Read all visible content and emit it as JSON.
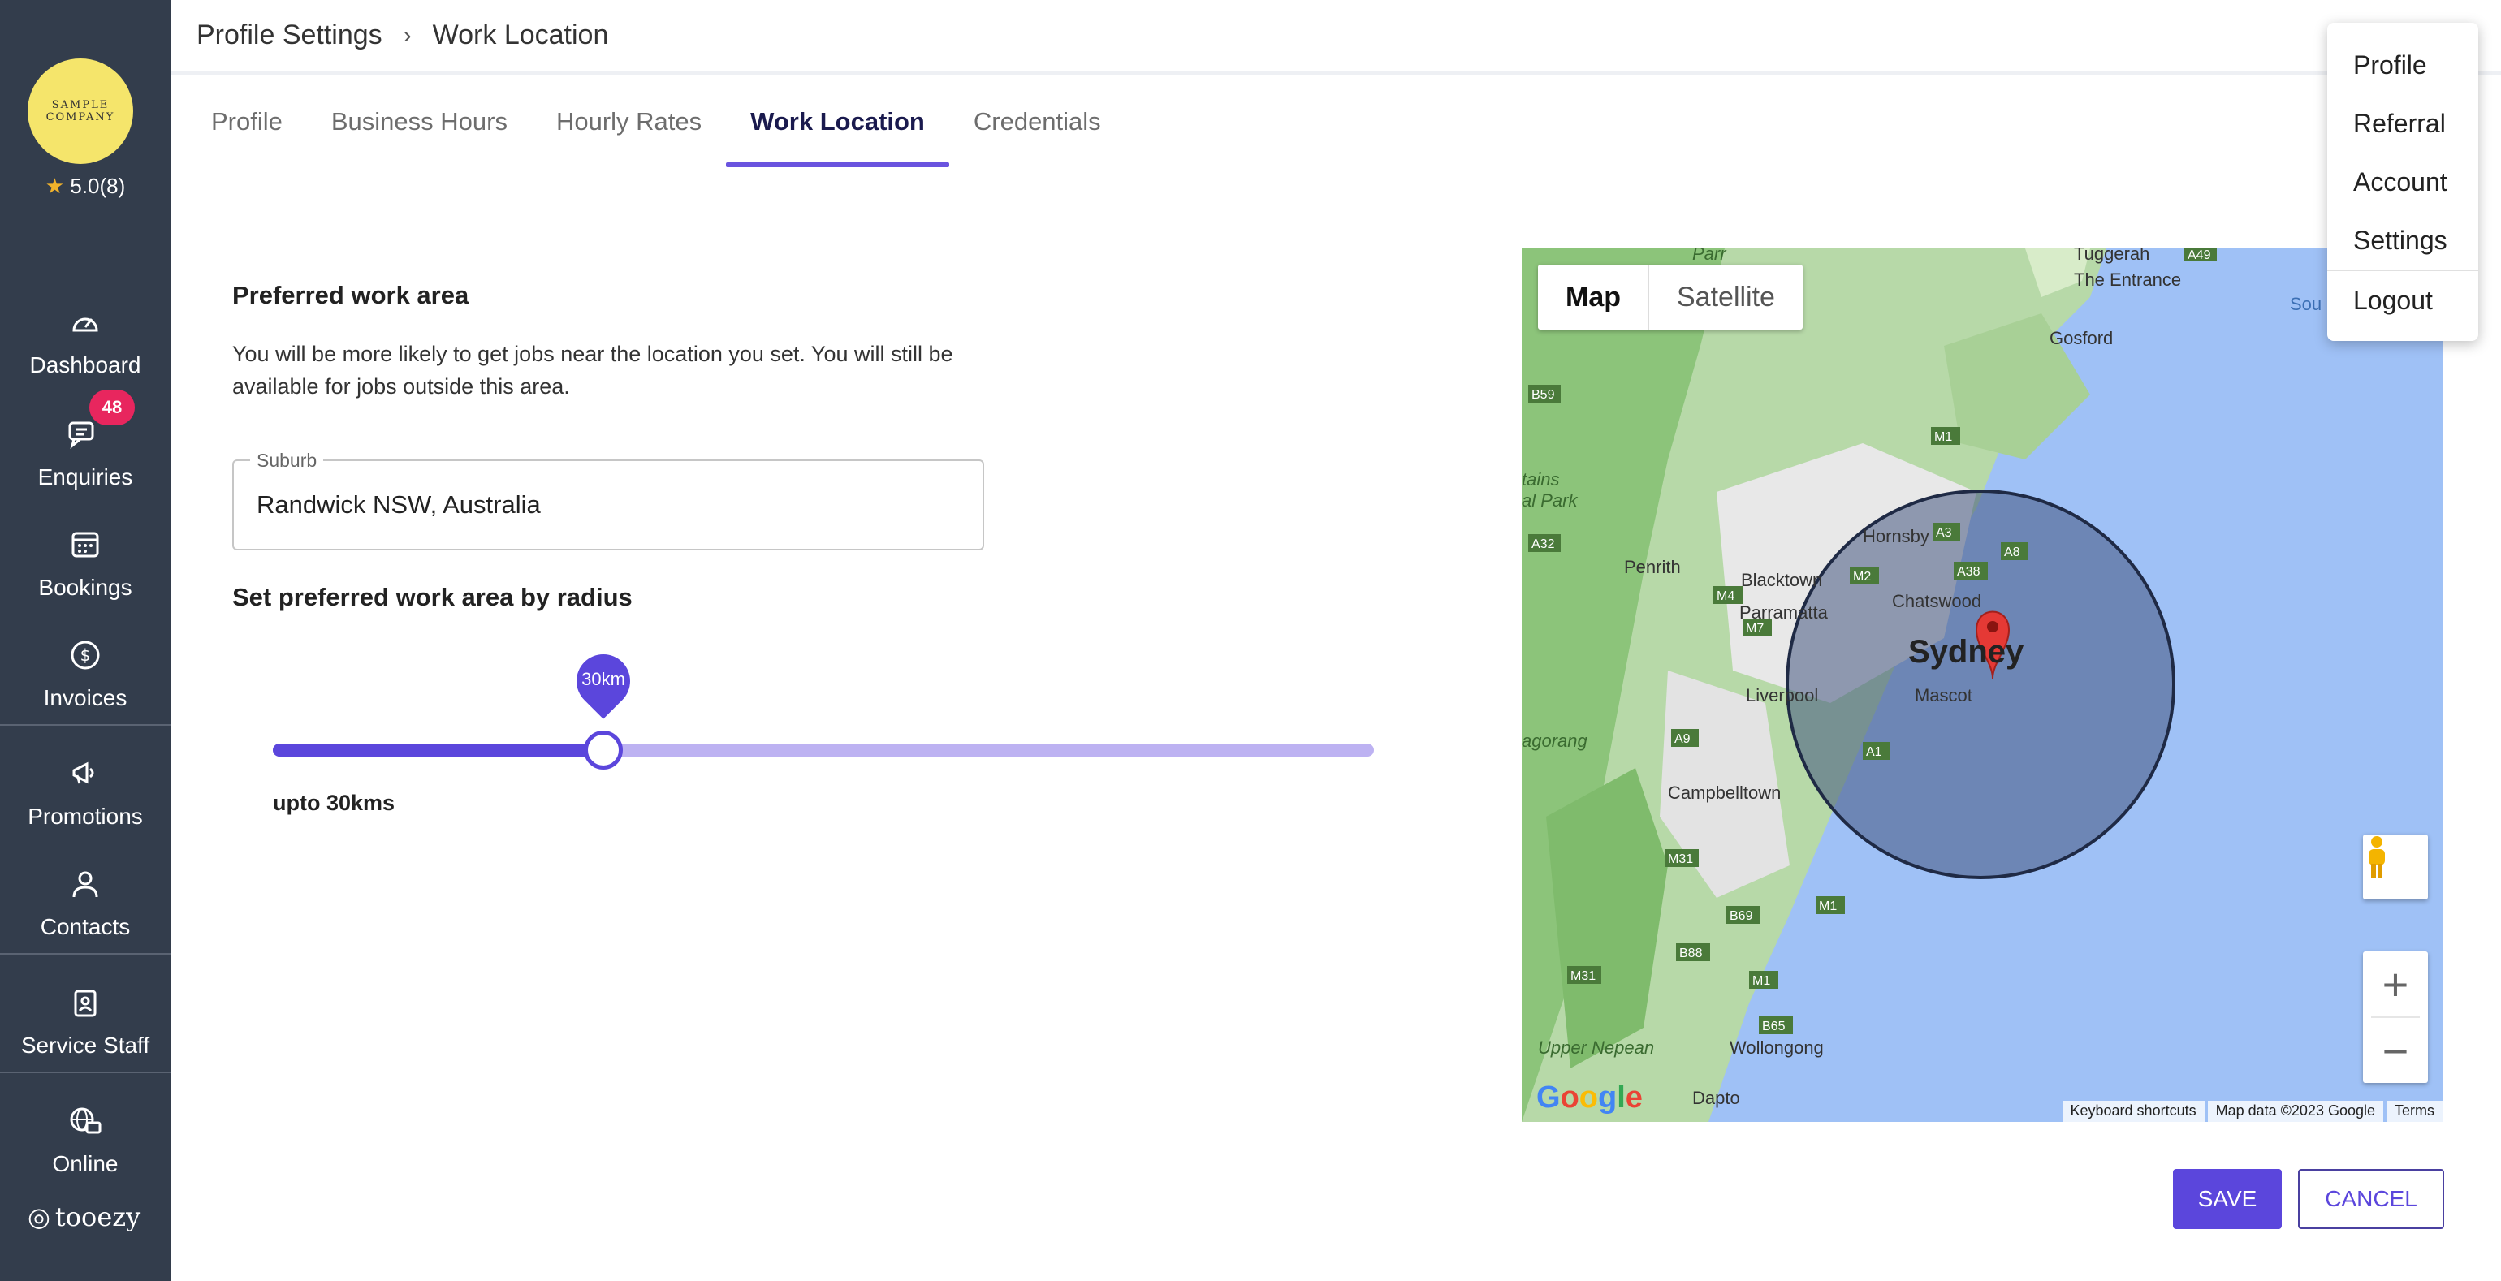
{
  "sidebar": {
    "logo_text_1": "SAMPLE",
    "logo_text_2": "COMPANY",
    "rating": "5.0(8)",
    "items": [
      {
        "label": "Dashboard"
      },
      {
        "label": "Enquiries",
        "badge": "48"
      },
      {
        "label": "Bookings"
      },
      {
        "label": "Invoices"
      },
      {
        "label": "Promotions"
      },
      {
        "label": "Contacts"
      },
      {
        "label": "Service Staff"
      },
      {
        "label": "Online"
      }
    ],
    "brand": "tooezy"
  },
  "header": {
    "breadcrumb_parent": "Profile Settings",
    "breadcrumb_current": "Work Location"
  },
  "tabs": [
    {
      "label": "Profile"
    },
    {
      "label": "Business Hours"
    },
    {
      "label": "Hourly Rates"
    },
    {
      "label": "Work Location",
      "active": true
    },
    {
      "label": "Credentials"
    }
  ],
  "content": {
    "preferred_title": "Preferred work area",
    "description": "You will be more likely to get jobs near the location you set. You will still be available for jobs outside this area.",
    "suburb_label": "Suburb",
    "suburb_value": "Randwick NSW, Australia",
    "radius_title": "Set preferred work area by radius",
    "slider_value_label": "30km",
    "slider_fraction": 0.3,
    "radius_text": "upto 30kms"
  },
  "map": {
    "type_map": "Map",
    "type_satellite": "Satellite",
    "places": [
      "Tuggerah",
      "The Entrance",
      "Gosford",
      "Hornsby",
      "Penrith",
      "Blacktown",
      "Chatswood",
      "Parramatta",
      "Sydney",
      "Liverpool",
      "Mascot",
      "Campbelltown",
      "Wollongong",
      "Dapto",
      "Upper Nepean",
      "agorang",
      "tains",
      "al Park",
      "Parr",
      "Sou"
    ],
    "roads": [
      "A49",
      "M1",
      "B59",
      "A32",
      "A3",
      "A8",
      "A38",
      "M2",
      "M4",
      "M7",
      "A9",
      "A1",
      "M31",
      "B69",
      "B88",
      "M1",
      "M31",
      "B65",
      "M1"
    ],
    "footer_shortcuts": "Keyboard shortcuts",
    "footer_data": "Map data ©2023 Google",
    "footer_terms": "Terms",
    "google": "Google"
  },
  "actions": {
    "save": "SAVE",
    "cancel": "CANCEL"
  },
  "menu": {
    "items": [
      "Profile",
      "Referral",
      "Account",
      "Settings",
      "Logout"
    ]
  },
  "colors": {
    "sidebar": "#333d4c",
    "accent": "#5b46dc",
    "badge": "#e8265e",
    "water": "#9fc1f6"
  }
}
